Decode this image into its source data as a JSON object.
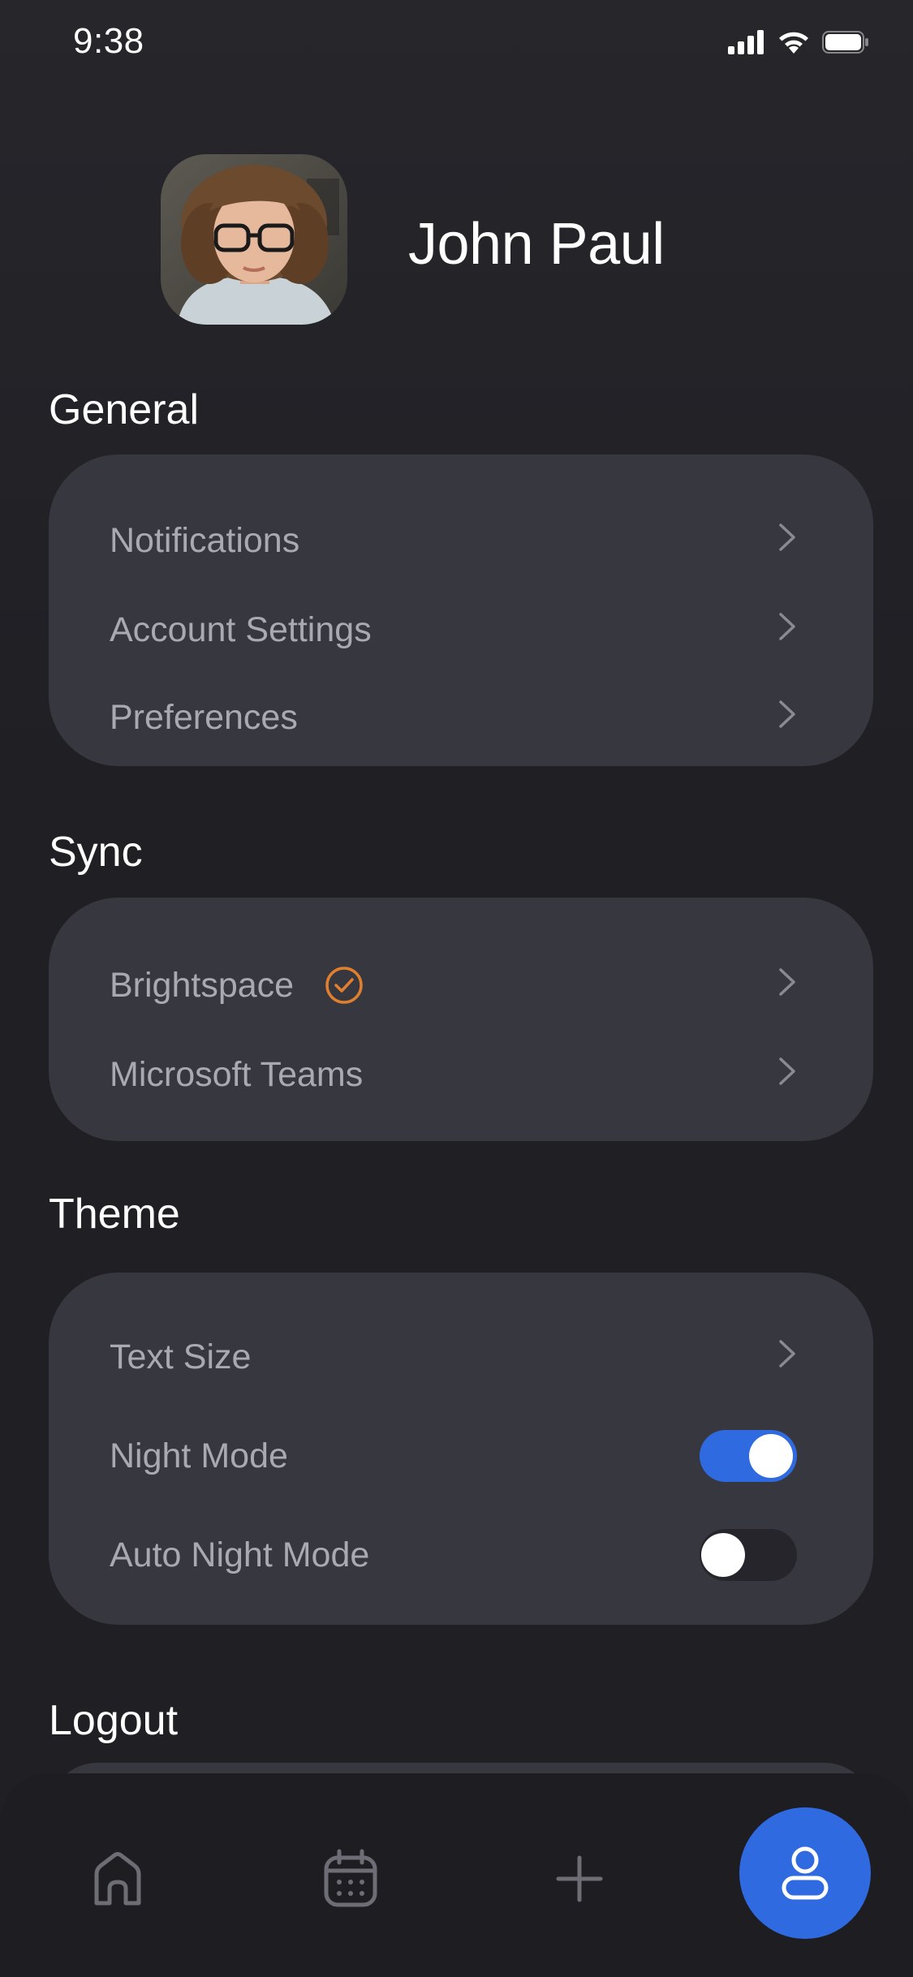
{
  "status_bar": {
    "time": "9:38",
    "icons": [
      "cellular-signal-icon",
      "wifi-icon",
      "battery-icon"
    ]
  },
  "profile": {
    "name": "John Paul",
    "avatar_icon": "user-photo-avatar"
  },
  "sections": {
    "general": {
      "title": "General",
      "items": [
        {
          "label": "Notifications",
          "icon": "chevron-right-icon"
        },
        {
          "label": "Account Settings",
          "icon": "chevron-right-icon"
        },
        {
          "label": "Preferences",
          "icon": "chevron-right-icon"
        }
      ]
    },
    "sync": {
      "title": "Sync",
      "items": [
        {
          "label": "Brightspace",
          "badge": "check-circle-icon",
          "icon": "chevron-right-icon"
        },
        {
          "label": "Microsoft Teams",
          "icon": "chevron-right-icon"
        }
      ]
    },
    "theme": {
      "title": "Theme",
      "items": [
        {
          "label": "Text Size",
          "icon": "chevron-right-icon"
        },
        {
          "label": "Night Mode",
          "toggle": true
        },
        {
          "label": "Auto Night Mode",
          "toggle": false
        }
      ]
    },
    "logout": {
      "title": "Logout"
    }
  },
  "tabbar": {
    "tabs": [
      {
        "name": "home",
        "icon": "home-icon",
        "active": false
      },
      {
        "name": "calendar",
        "icon": "calendar-icon",
        "active": false
      },
      {
        "name": "add",
        "icon": "plus-icon",
        "active": false
      },
      {
        "name": "profile",
        "icon": "profile-icon",
        "active": true
      }
    ]
  },
  "colors": {
    "background": "#1f1f24",
    "card": "#37373f",
    "accent": "#2f6ae0",
    "badge": "#e0802f",
    "label": "#a9a9b1"
  }
}
